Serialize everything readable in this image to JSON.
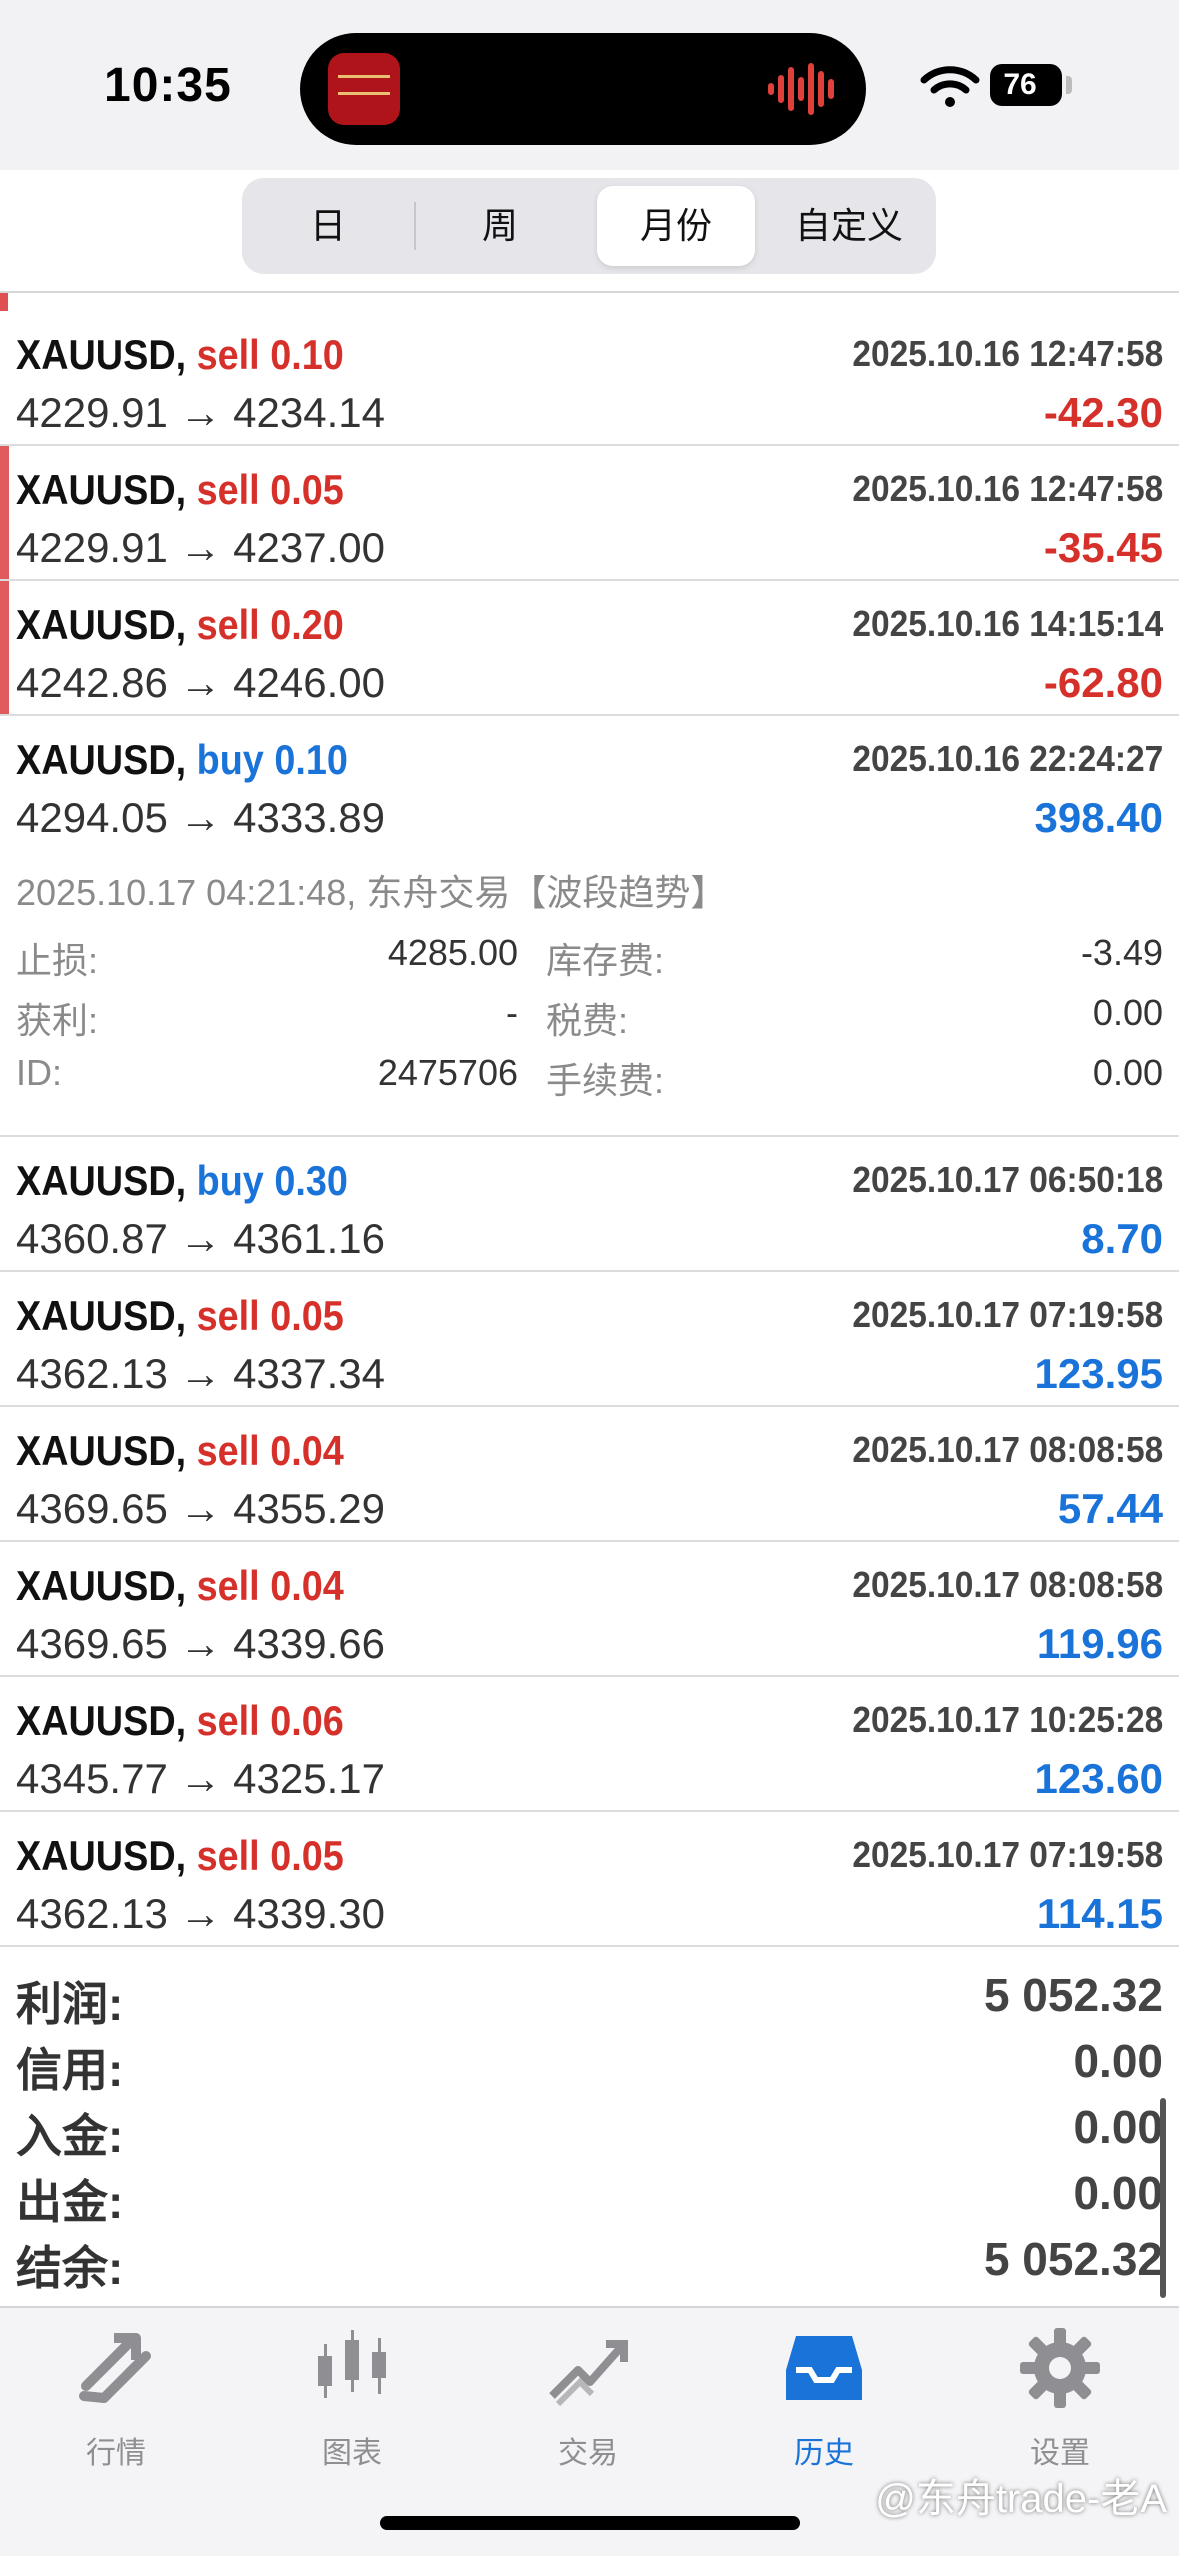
{
  "status_bar": {
    "time": "10:35",
    "battery": "76"
  },
  "period_tabs": [
    {
      "label": "日",
      "active": false
    },
    {
      "label": "周",
      "active": false
    },
    {
      "label": "月份",
      "active": true
    },
    {
      "label": "自定义",
      "active": false
    }
  ],
  "trades": [
    {
      "symbol": "XAUUSD,",
      "side": "sell",
      "volume": "0.10",
      "time": "2025.10.16 12:47:58",
      "prices": "4229.91 → 4234.14",
      "profit": "-42.30"
    },
    {
      "symbol": "XAUUSD,",
      "side": "sell",
      "volume": "0.05",
      "time": "2025.10.16 12:47:58",
      "prices": "4229.91 → 4237.00",
      "profit": "-35.45"
    },
    {
      "symbol": "XAUUSD,",
      "side": "sell",
      "volume": "0.20",
      "time": "2025.10.16 14:15:14",
      "prices": "4242.86 → 4246.00",
      "profit": "-62.80"
    },
    {
      "symbol": "XAUUSD,",
      "side": "buy",
      "volume": "0.10",
      "time": "2025.10.16 22:24:27",
      "prices": "4294.05 → 4333.89",
      "profit": "398.40"
    },
    {
      "symbol": "XAUUSD,",
      "side": "buy",
      "volume": "0.30",
      "time": "2025.10.17 06:50:18",
      "prices": "4360.87 → 4361.16",
      "profit": "8.70"
    },
    {
      "symbol": "XAUUSD,",
      "side": "sell",
      "volume": "0.05",
      "time": "2025.10.17 07:19:58",
      "prices": "4362.13 → 4337.34",
      "profit": "123.95"
    },
    {
      "symbol": "XAUUSD,",
      "side": "sell",
      "volume": "0.04",
      "time": "2025.10.17 08:08:58",
      "prices": "4369.65 → 4355.29",
      "profit": "57.44"
    },
    {
      "symbol": "XAUUSD,",
      "side": "sell",
      "volume": "0.04",
      "time": "2025.10.17 08:08:58",
      "prices": "4369.65 → 4339.66",
      "profit": "119.96"
    },
    {
      "symbol": "XAUUSD,",
      "side": "sell",
      "volume": "0.06",
      "time": "2025.10.17 10:25:28",
      "prices": "4345.77 → 4325.17",
      "profit": "123.60"
    },
    {
      "symbol": "XAUUSD,",
      "side": "sell",
      "volume": "0.05",
      "time": "2025.10.17 07:19:58",
      "prices": "4362.13 → 4339.30",
      "profit": "114.15"
    }
  ],
  "detail": {
    "header": "2025.10.17 04:21:48, 东舟交易【波段趋势】",
    "stop_loss_label": "止损:",
    "stop_loss": "4285.00",
    "swap_label": "库存费:",
    "swap": "-3.49",
    "take_profit_label": "获利:",
    "take_profit": "-",
    "tax_label": "税费:",
    "tax": "0.00",
    "id_label": "ID:",
    "id": "2475706",
    "commission_label": "手续费:",
    "commission": "0.00"
  },
  "summary": [
    {
      "label": "利润:",
      "value": "5 052.32"
    },
    {
      "label": "信用:",
      "value": "0.00"
    },
    {
      "label": "入金:",
      "value": "0.00"
    },
    {
      "label": "出金:",
      "value": "0.00"
    },
    {
      "label": "结余:",
      "value": "5 052.32"
    }
  ],
  "tabbar": [
    {
      "label": "行情",
      "icon": "quotes-arrows-icon",
      "active": false
    },
    {
      "label": "图表",
      "icon": "candlestick-chart-icon",
      "active": false
    },
    {
      "label": "交易",
      "icon": "trade-trend-icon",
      "active": false
    },
    {
      "label": "历史",
      "icon": "history-inbox-icon",
      "active": true
    },
    {
      "label": "设置",
      "icon": "gear-icon",
      "active": false
    }
  ],
  "watermark": "@东舟trade-老A",
  "colors": {
    "sell": "#d6302b",
    "buy": "#1a73d9",
    "loss": "#d6302b",
    "profit": "#1a73d9",
    "accent": "#1a73d9"
  }
}
